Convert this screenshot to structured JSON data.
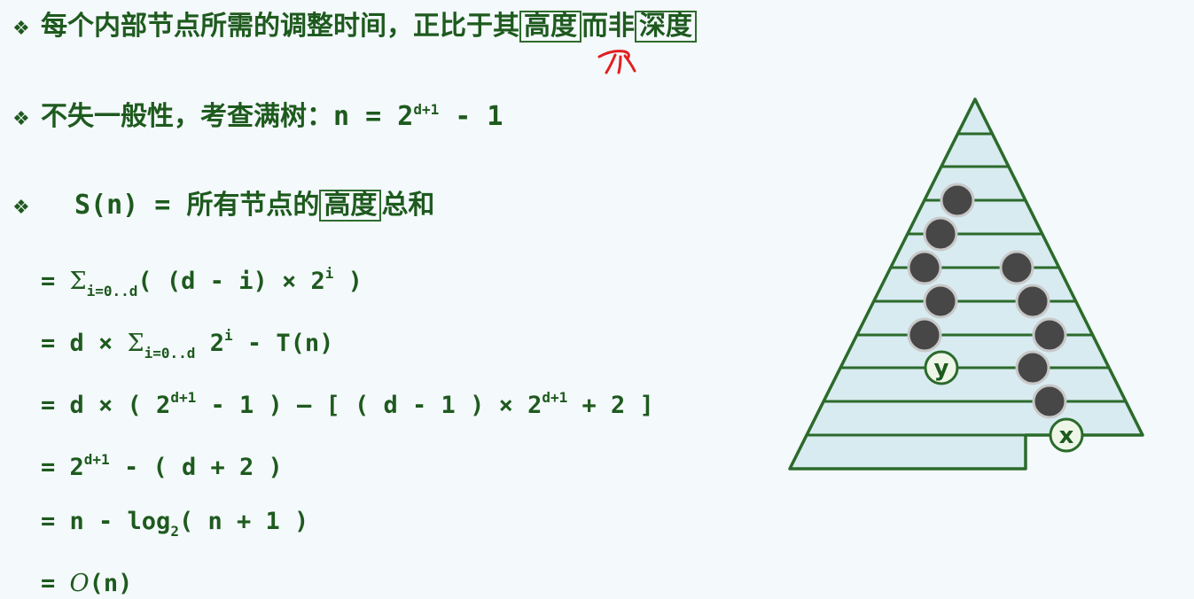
{
  "bullets": {
    "symbol": "❖",
    "line1": {
      "text": "每个内部节点所需的调整时间，正比于其",
      "box1": "高度",
      "mid": "而非",
      "box2": "深度"
    },
    "line2": {
      "text": "不失一般性，考查满树：",
      "formula": "n = 2",
      "exp": "d+1",
      "tail": " - 1"
    },
    "line3": {
      "lhs": "S(n) = ",
      "text": "所有节点的",
      "box": "高度",
      "tail": "总和"
    }
  },
  "equations": {
    "e1": {
      "pre": "= ",
      "sum": "Σ",
      "sub": "i=0..d",
      "mid": "( (d - i) × 2",
      "sup": "i",
      "post": " )"
    },
    "e2": {
      "pre": "= d × ",
      "sum": "Σ",
      "sub": "i=0..d",
      "mid": " 2",
      "sup": "i",
      "post": " - T(n)"
    },
    "e3": {
      "pre": "= d × ( 2",
      "sup1": "d+1",
      "mid": " - 1 ) – [ ( d - 1 ) × 2",
      "sup2": "d+1",
      "post": " + 2 ]"
    },
    "e4": {
      "pre": "= 2",
      "sup": "d+1",
      "post": " - ( d + 2 )"
    },
    "e5": {
      "pre": "= n - log",
      "sub": "2",
      "post": "( n + 1 )"
    },
    "e6": {
      "pre": "= ",
      "o": "O",
      "post": "(n)"
    }
  },
  "diagram": {
    "label_y": "y",
    "label_x": "x"
  },
  "colors": {
    "text": "#1e5a1e",
    "tree_fill": "#d8ebf0",
    "tree_stroke": "#2b6a2b",
    "node": "#4a4a4a",
    "annotation": "#e02020"
  }
}
